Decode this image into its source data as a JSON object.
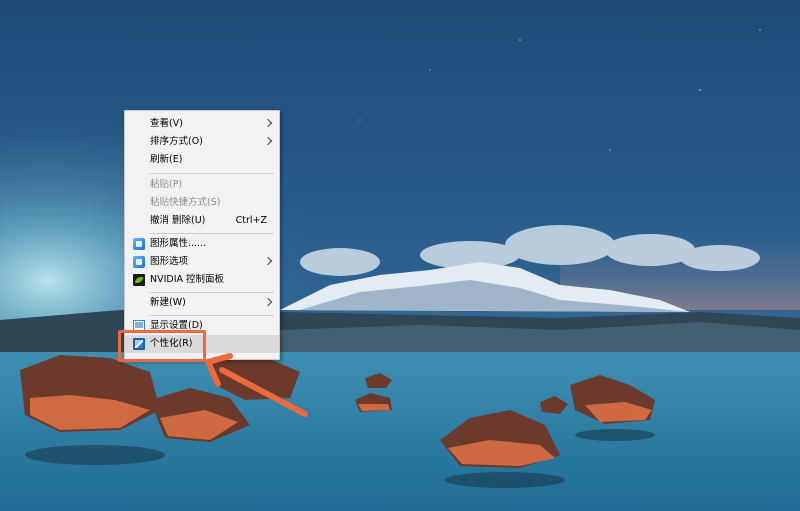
{
  "menu": {
    "items": [
      {
        "label": "查看(V)",
        "has_submenu": true
      },
      {
        "label": "排序方式(O)",
        "has_submenu": true
      },
      {
        "label": "刷新(E)"
      },
      {
        "label": "粘贴(P)",
        "disabled": true
      },
      {
        "label": "粘贴快捷方式(S)",
        "disabled": true
      },
      {
        "label": "撤消 删除(U)",
        "shortcut": "Ctrl+Z"
      },
      {
        "label": "图形属性......",
        "icon": "intel-graphics-icon"
      },
      {
        "label": "图形选项",
        "icon": "intel-graphics-icon",
        "has_submenu": true
      },
      {
        "label": "NVIDIA 控制面板",
        "icon": "nvidia-icon"
      },
      {
        "label": "新建(W)",
        "has_submenu": true
      },
      {
        "label": "显示设置(D)",
        "icon": "display-settings-icon"
      },
      {
        "label": "个性化(R)",
        "icon": "personalize-icon",
        "highlighted": true
      }
    ]
  },
  "annotation": {
    "highlight_color": "#ec6a3b"
  }
}
